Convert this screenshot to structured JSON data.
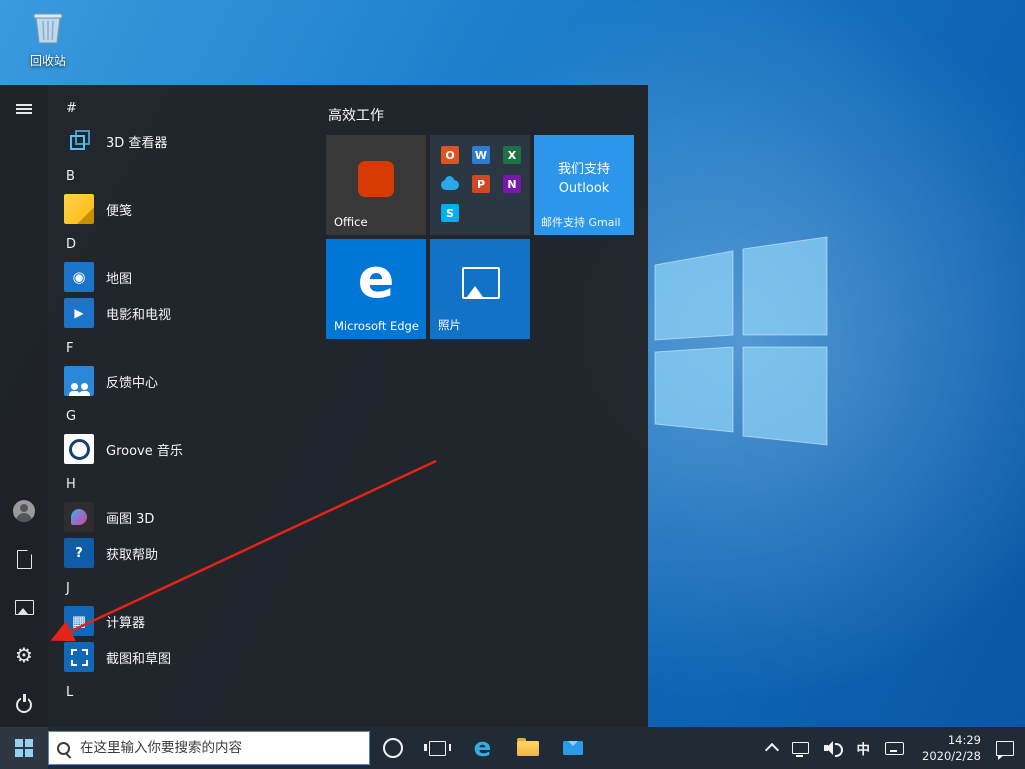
{
  "desktop": {
    "recycle_bin_label": "回收站"
  },
  "start_menu": {
    "tile_group_title": "高效工作",
    "app_sections": [
      {
        "header": "#",
        "apps": [
          {
            "name": "3D 查看器"
          }
        ]
      },
      {
        "header": "B",
        "apps": [
          {
            "name": "便笺"
          }
        ]
      },
      {
        "header": "D",
        "apps": [
          {
            "name": "地图"
          },
          {
            "name": "电影和电视"
          }
        ]
      },
      {
        "header": "F",
        "apps": [
          {
            "name": "反馈中心"
          }
        ]
      },
      {
        "header": "G",
        "apps": [
          {
            "name": "Groove 音乐"
          }
        ]
      },
      {
        "header": "H",
        "apps": [
          {
            "name": "画图 3D"
          },
          {
            "name": "获取帮助"
          }
        ]
      },
      {
        "header": "J",
        "apps": [
          {
            "name": "计算器"
          },
          {
            "name": "截图和草图"
          }
        ]
      },
      {
        "header": "L",
        "apps": []
      }
    ],
    "tiles": {
      "office": {
        "label": "Office",
        "bg": "#383838",
        "logo_color": "#d83b01"
      },
      "suite": {
        "bg": "#2b3844",
        "apps": [
          {
            "name": "office",
            "letter": "O",
            "color": "#e0531f"
          },
          {
            "name": "word",
            "letter": "W",
            "color": "#2b7cd3"
          },
          {
            "name": "excel",
            "letter": "X",
            "color": "#1e7145"
          },
          {
            "name": "onedrive",
            "letter": "",
            "color": "#28a8ea"
          },
          {
            "name": "powerpoint",
            "letter": "P",
            "color": "#d24726"
          },
          {
            "name": "onenote",
            "letter": "N",
            "color": "#7719aa"
          },
          {
            "name": "skype",
            "letter": "S",
            "color": "#00aff0"
          }
        ]
      },
      "mail": {
        "bg": "#2b96ea",
        "headline": "我们支持 Outlook",
        "footer": "邮件支持 Gmail"
      },
      "edge": {
        "bg": "#0076d7",
        "letter": "e",
        "label": "Microsoft Edge"
      },
      "photos": {
        "bg": "#1273c6",
        "label": "照片"
      }
    }
  },
  "taskbar": {
    "search_placeholder": "在这里输入你要搜索的内容",
    "ime": "中",
    "time": "14:29",
    "date": "2020/2/28"
  },
  "colors": {
    "accent": "#0078d7",
    "annotation_arrow": "#e32417"
  }
}
